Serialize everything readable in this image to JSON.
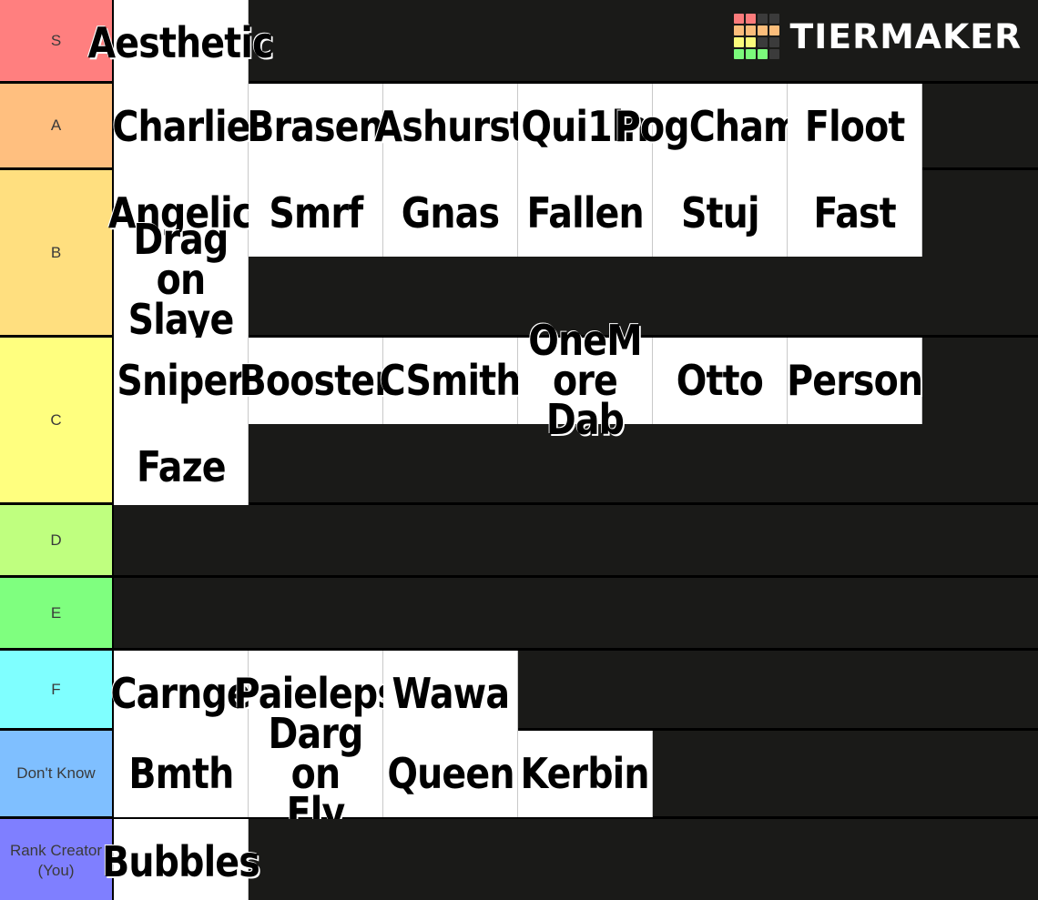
{
  "logo": {
    "name": "TIERMAKER",
    "grid_colors": [
      [
        "#fb7b7b",
        "#fb7b7b",
        "#3b3b3b",
        "#3b3b3b"
      ],
      [
        "#fbbd7b",
        "#fbbd7b",
        "#fbbd7b",
        "#fbbd7b"
      ],
      [
        "#fbfb7b",
        "#fbfb7b",
        "#3b3b3b",
        "#3b3b3b"
      ],
      [
        "#7bfb7b",
        "#7bfb7b",
        "#7bfb7b",
        "#3b3b3b"
      ]
    ]
  },
  "background_color": "#1a1a18",
  "tiers": [
    {
      "label": "S",
      "color": "#ff7f7f",
      "height": 92,
      "items": [
        "Aesthetic"
      ]
    },
    {
      "label": "A",
      "color": "#ffbf7f",
      "height": 95,
      "items": [
        "Charlie",
        "Brasen",
        "Ashurst",
        "Qui1ln",
        "PogChamp",
        "Floot"
      ]
    },
    {
      "label": "B",
      "color": "#ffdf7f",
      "height": 184,
      "items": [
        "Angelic",
        "Smrf",
        "Gnas",
        "Fallen",
        "Stuj",
        "Fast",
        "Dragon Slayer"
      ]
    },
    {
      "label": "C",
      "color": "#ffff7f",
      "height": 184,
      "items": [
        "Sniper",
        "Booster",
        "CSmith",
        "OneMore Dab",
        "Otto",
        "Person",
        "Faze"
      ]
    },
    {
      "label": "D",
      "color": "#bfff7f",
      "height": 80,
      "items": []
    },
    {
      "label": "E",
      "color": "#7fff7f",
      "height": 80,
      "items": []
    },
    {
      "label": "F",
      "color": "#7fffff",
      "height": 88,
      "items": [
        "Carnge",
        "Paieleps",
        "Wawa"
      ]
    },
    {
      "label": "Don't Know",
      "color": "#7fbfff",
      "height": 97,
      "items": [
        "Bmth",
        "Dargon Fly",
        "Queen",
        "Kerbin"
      ]
    },
    {
      "label": "Rank Creator (You)",
      "color": "#7f7fff",
      "height": 91,
      "items": [
        "Bubbles"
      ]
    }
  ]
}
